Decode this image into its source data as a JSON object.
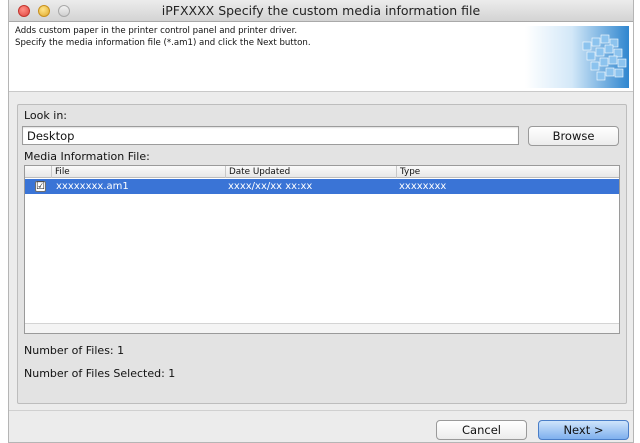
{
  "window": {
    "title": "iPFXXXX Specify the custom media information file"
  },
  "header": {
    "line1": "Adds custom paper in the printer control panel and printer driver.",
    "line2": "Specify the media information file (*.am1) and click the Next button."
  },
  "look_in": {
    "label": "Look in:",
    "value": "Desktop",
    "browse_label": "Browse"
  },
  "media": {
    "label": "Media Information File:",
    "columns": {
      "file": "File",
      "date": "Date Updated",
      "type": "Type"
    },
    "rows": [
      {
        "checked": true,
        "check_glyph": "☑",
        "file": "xxxxxxxx.am1",
        "date": "xxxx/xx/xx xx:xx",
        "type": "xxxxxxxx"
      }
    ]
  },
  "status": {
    "files": "Number of Files: 1",
    "selected": "Number of Files Selected: 1"
  },
  "buttons": {
    "cancel": "Cancel",
    "next": "Next >"
  },
  "colors": {
    "selection": "#3a74d6",
    "default_button": "#7fb0ee",
    "close": "#e0443e",
    "minimize": "#e0a92a"
  },
  "icons": [
    "close-icon",
    "minimize-icon",
    "zoom-icon",
    "checkbox-icon",
    "printer-media-logo"
  ]
}
